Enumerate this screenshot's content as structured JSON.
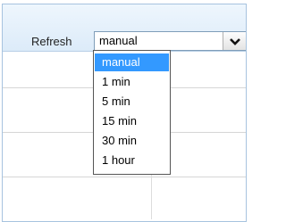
{
  "toolbar": {
    "refresh_label": "Refresh",
    "refresh_select": {
      "value": "manual",
      "arrow_icon": "chevron-down-icon"
    }
  },
  "dropdown": {
    "options": [
      {
        "label": "manual",
        "selected": true
      },
      {
        "label": "1 min",
        "selected": false
      },
      {
        "label": "5 min",
        "selected": false
      },
      {
        "label": "15 min",
        "selected": false
      },
      {
        "label": "30 min",
        "selected": false
      },
      {
        "label": "1 hour",
        "selected": false
      }
    ]
  },
  "colors": {
    "highlight": "#3399ff",
    "header_top": "#eef6fd",
    "header_bottom": "#dcebf9",
    "border": "#a7c3df"
  }
}
